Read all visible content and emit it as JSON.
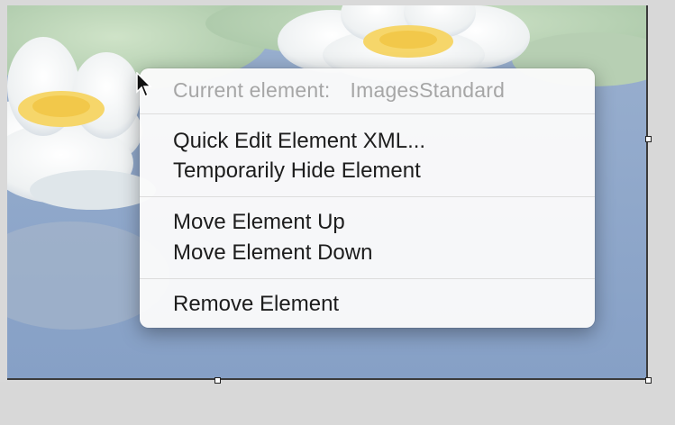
{
  "menu": {
    "header_label": "Current element:",
    "header_value": "ImagesStandard",
    "items": [
      {
        "label": "Quick Edit Element XML..."
      },
      {
        "label": "Temporarily Hide Element"
      },
      {
        "label": "Move Element Up"
      },
      {
        "label": "Move Element Down"
      },
      {
        "label": "Remove Element"
      }
    ]
  },
  "colors": {
    "canvas_background": "#d9d9d9",
    "photo_water": "#8aa2c6",
    "menu_background": "#fafafa",
    "menu_header_text": "#a6a6a6",
    "menu_item_text": "#1d1d1d"
  }
}
